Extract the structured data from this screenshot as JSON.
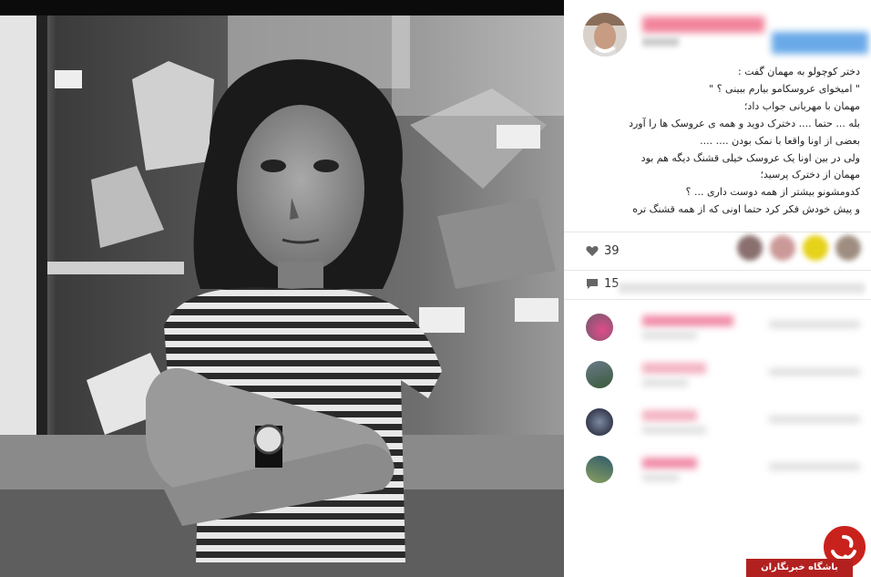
{
  "caption": {
    "lines": [
      "دختر کوچولو به مهمان گفت :",
      "\" امیخوای عروسکامو بیارم ببینی ؟ \"",
      "مهمان با مهربانی جواب داد؛",
      "بله ... حتما .... دخترک دوید و همه ی عروسک ها را آورد",
      "بعضی از اونا واقعا با نمک بودن .... ....",
      "ولی در بین اونا یک عروسک خیلی قشنگ دیگه هم بود",
      "مهمان از دخترک پرسید؛",
      "کدومشونو بیشتر از همه دوست داری ... ؟",
      "و پیش خودش فکر کرد حتما اونی که از همه قشنگ تره"
    ]
  },
  "stats": {
    "likes_partial": "39",
    "comments_partial": "15"
  },
  "icons": {
    "like": "heart-icon",
    "comment": "speech-bubble-icon"
  },
  "colors": {
    "username_blur": "#f06f8a",
    "follow_blur": "#5aa0e6",
    "watermark": "#b2211f"
  },
  "watermark": {
    "text": "باشگاه خبرنگاران"
  }
}
